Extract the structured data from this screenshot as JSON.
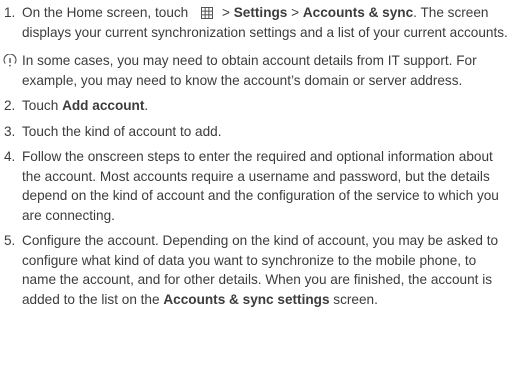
{
  "step1": {
    "num": "1.",
    "before": "On the Home screen, touch",
    "icon": "all-apps-grid-icon",
    "arrow1": "> ",
    "settings": "Settings",
    "arrow2": " > ",
    "accounts_sync": "Accounts & sync",
    "after": ". The screen displays your current synchronization settings and a list of your current accounts."
  },
  "note": {
    "icon": "info-note-icon",
    "text": "In some cases, you may need to obtain account details from IT support. For example, you may need to know the account’s domain or server address."
  },
  "step2": {
    "num": "2.",
    "before": "Touch ",
    "bold": "Add account",
    "after": "."
  },
  "step3": {
    "num": "3.",
    "text": "Touch the kind of account to add."
  },
  "step4": {
    "num": "4.",
    "text": "Follow the onscreen steps to enter the required and optional information about the account. Most accounts require a username and password, but the details depend on the kind of account and the configuration of the service to which you are connecting."
  },
  "step5": {
    "num": "5.",
    "text": "Configure the account. Depending on the kind of account, you may be asked to configure what kind of data you want to synchronize to the mobile phone, to name the account, and for other details. When you are finished, the account is added to the list on the ",
    "bold": "Accounts & sync settings",
    "after": " screen."
  }
}
